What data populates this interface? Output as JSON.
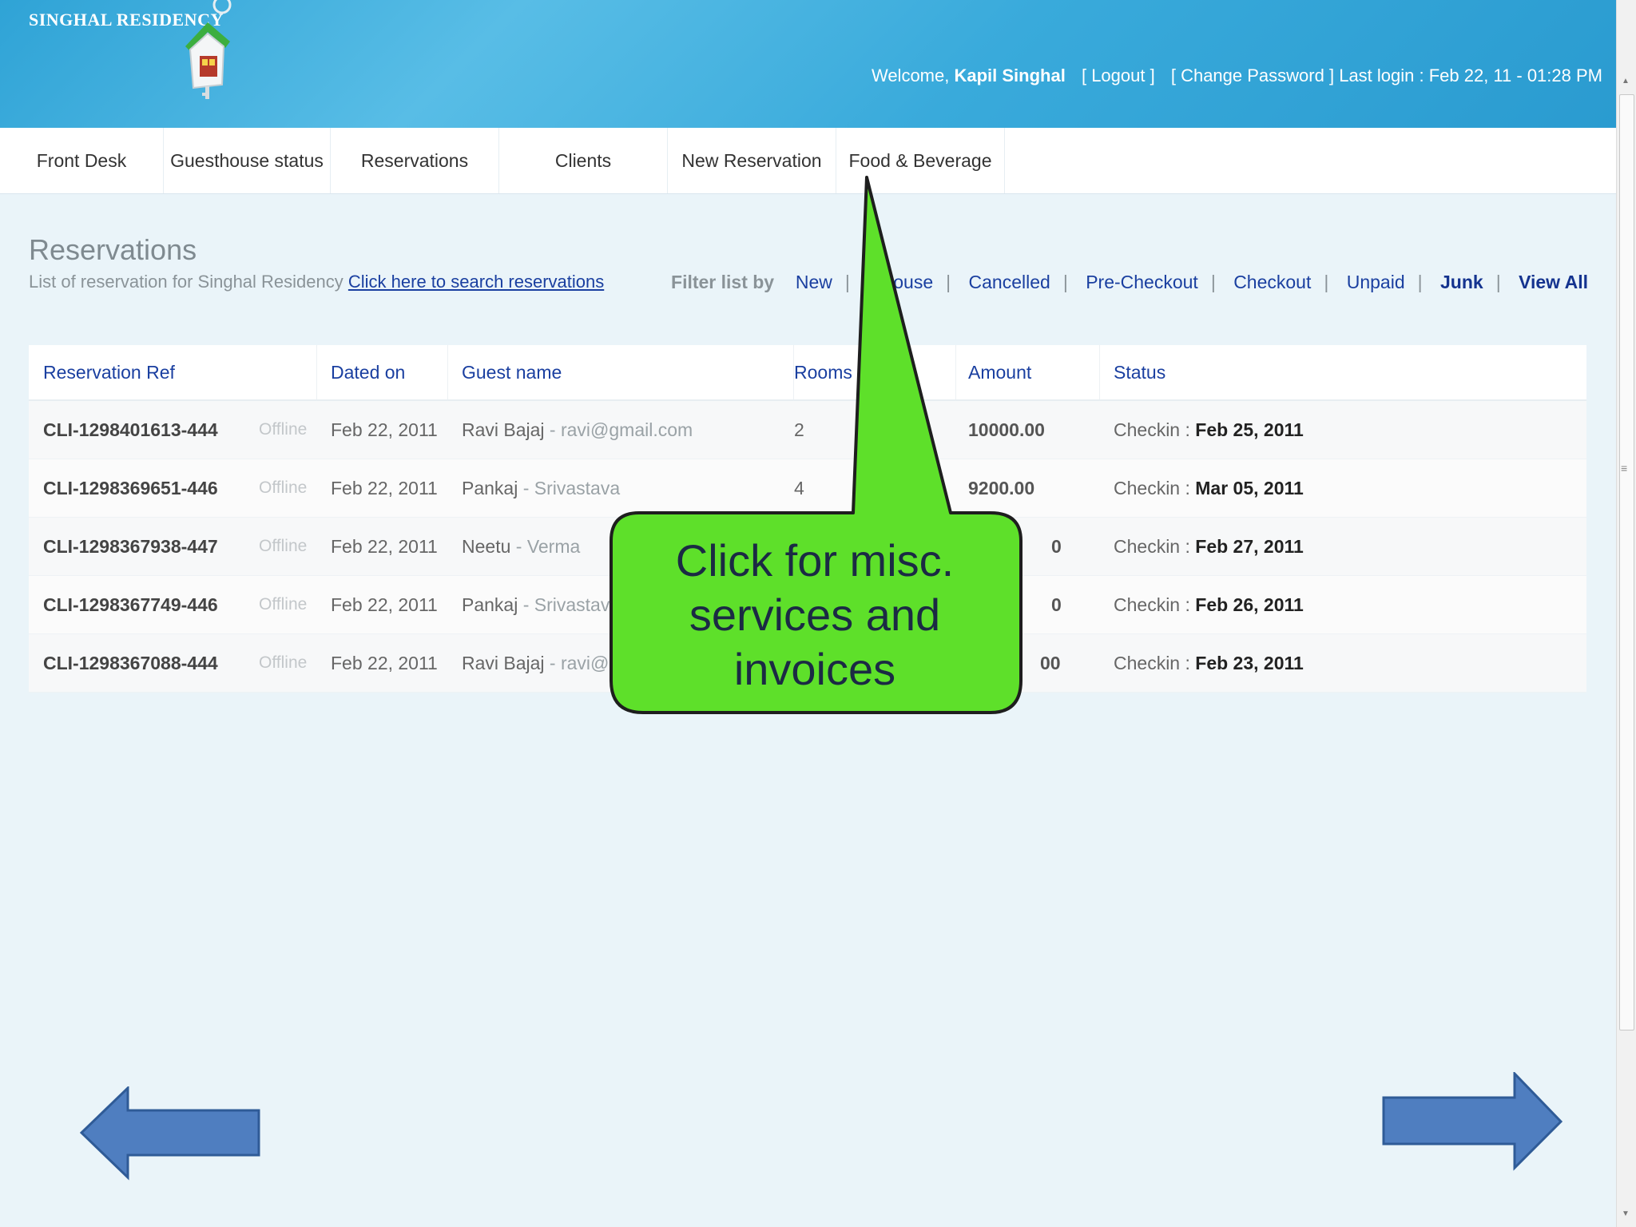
{
  "header": {
    "brand": "SINGHAL RESIDENCY",
    "welcome_prefix": "Welcome,",
    "user_name": "Kapil Singhal",
    "logout": "[ Logout ]",
    "change_password": "[ Change Password ]",
    "last_login": "Last login : Feb 22, 11 - 01:28 PM"
  },
  "nav": {
    "items": [
      {
        "label": "Front Desk"
      },
      {
        "label": "Guesthouse status"
      },
      {
        "label": "Reservations"
      },
      {
        "label": "Clients"
      },
      {
        "label": "New Reservation"
      },
      {
        "label": "Food & Beverage"
      }
    ]
  },
  "main": {
    "title": "Reservations",
    "subtitle": "List of reservation for Singhal Residency",
    "search_link": "Click here to search reservations",
    "filter_label": "Filter list by",
    "filters": [
      "New",
      "Inhouse",
      "Cancelled",
      "Pre-Checkout",
      "Checkout",
      "Unpaid",
      "Junk",
      "View All"
    ]
  },
  "table": {
    "columns": [
      "Reservation Ref",
      "Dated on",
      "Guest name",
      "Rooms",
      "Amount",
      "Status"
    ],
    "rows": [
      {
        "ref": "CLI-1298401613-444",
        "state": "Offline",
        "date": "Feb 22, 2011",
        "guest": "Ravi Bajaj",
        "guest_extra": " - ravi@gmail.com",
        "rooms": "2",
        "amount": "10000.00",
        "status_label": "Checkin : ",
        "status_date": "Feb 25, 2011"
      },
      {
        "ref": "CLI-1298369651-446",
        "state": "Offline",
        "date": "Feb 22, 2011",
        "guest": "Pankaj",
        "guest_extra": " - Srivastava",
        "rooms": "4",
        "amount": "9200.00",
        "status_label": "Checkin : ",
        "status_date": "Mar 05, 2011"
      },
      {
        "ref": "CLI-1298367938-447",
        "state": "Offline",
        "date": "Feb 22, 2011",
        "guest": "Neetu",
        "guest_extra": " - Verma",
        "rooms": "",
        "amount": "0",
        "status_label": "Checkin : ",
        "status_date": "Feb 27, 2011"
      },
      {
        "ref": "CLI-1298367749-446",
        "state": "Offline",
        "date": "Feb 22, 2011",
        "guest": "Pankaj",
        "guest_extra": " - Srivastava",
        "rooms": "",
        "amount": "0",
        "status_label": "Checkin : ",
        "status_date": "Feb 26, 2011"
      },
      {
        "ref": "CLI-1298367088-444",
        "state": "Offline",
        "date": "Feb 22, 2011",
        "guest": "Ravi Bajaj",
        "guest_extra": " - ravi@gm",
        "rooms": "",
        "amount": "00",
        "status_label": "Checkin : ",
        "status_date": "Feb 23, 2011"
      }
    ]
  },
  "callout": {
    "text_line1": "Click for misc.",
    "text_line2": "services and",
    "text_line3": "invoices",
    "color": "#5ee02a"
  },
  "slide_nav": {
    "prev_icon": "arrow-left-icon",
    "next_icon": "arrow-right-icon",
    "color": "#4f7ec0"
  }
}
